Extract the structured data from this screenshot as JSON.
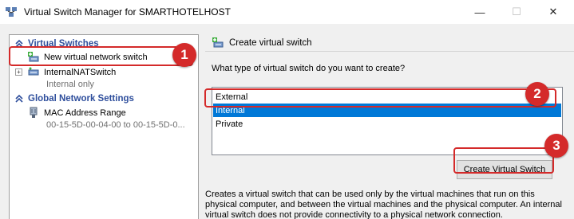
{
  "window": {
    "title": "Virtual Switch Manager for SMARTHOTELHOST",
    "minimize_glyph": "—",
    "maximize_glyph": "☐",
    "close_glyph": "✕"
  },
  "tree": {
    "virtual_switches_header": "Virtual Switches",
    "new_switch_label": "New virtual network switch",
    "internal_switch_name": "InternalNATSwitch",
    "internal_switch_type": "Internal only",
    "global_header": "Global Network Settings",
    "mac_range_label": "MAC Address Range",
    "mac_range_value": "00-15-5D-00-04-00 to 00-15-5D-0...",
    "expander_glyph": "+"
  },
  "panel": {
    "header": "Create virtual switch",
    "question": "What type of virtual switch do you want to create?",
    "options": [
      "External",
      "Internal",
      "Private"
    ],
    "selected_option": "Internal",
    "create_button": "Create Virtual Switch",
    "description": "Creates a virtual switch that can be used only by the virtual machines that run on this physical computer, and between the virtual machines and the physical computer. An internal virtual switch does not provide connectivity to a physical network connection."
  },
  "annotations": {
    "badges": [
      "1",
      "2",
      "3"
    ],
    "color": "#d42a2a"
  },
  "colors": {
    "selection": "#0078d7",
    "section_header": "#2e4e9c"
  }
}
